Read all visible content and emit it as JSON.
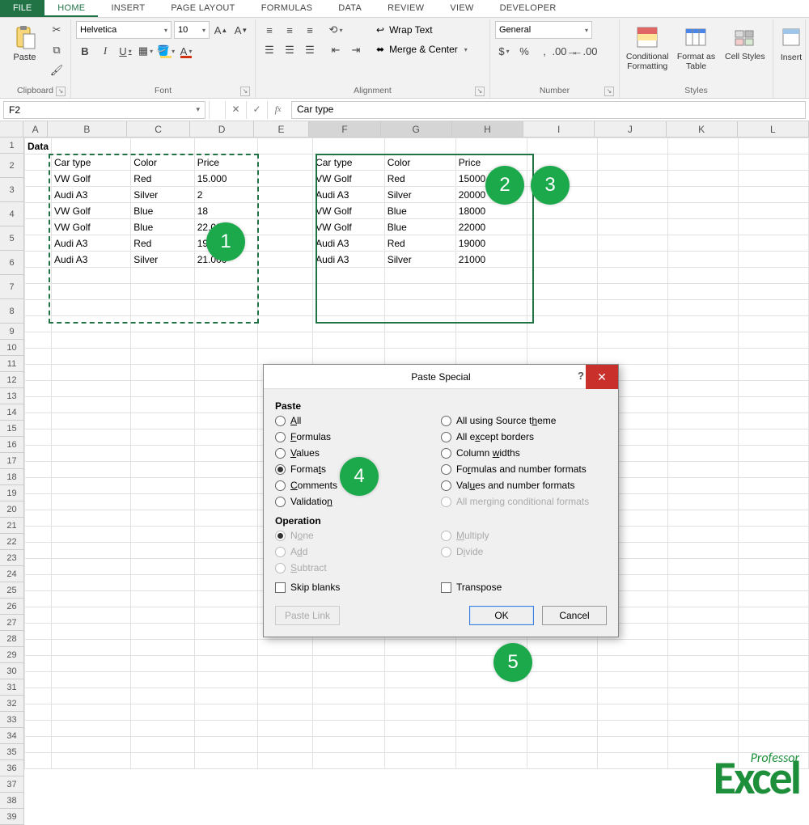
{
  "tabs": {
    "file": "FILE",
    "items": [
      "HOME",
      "INSERT",
      "PAGE LAYOUT",
      "FORMULAS",
      "DATA",
      "REVIEW",
      "VIEW",
      "DEVELOPER"
    ],
    "active": "HOME"
  },
  "ribbon": {
    "clipboard": {
      "paste": "Paste",
      "label": "Clipboard"
    },
    "font": {
      "name": "Helvetica",
      "size": "10",
      "label": "Font",
      "bold": "B",
      "italic": "I",
      "underline": "U"
    },
    "alignment": {
      "wrap": "Wrap Text",
      "merge": "Merge & Center",
      "label": "Alignment"
    },
    "number": {
      "format": "General",
      "label": "Number"
    },
    "styles": {
      "cond": "Conditional Formatting",
      "fmt": "Format as Table",
      "cell": "Cell Styles",
      "label": "Styles"
    },
    "cells": {
      "insert": "Insert"
    }
  },
  "formula_bar": {
    "name_box": "F2",
    "formula": "Car type"
  },
  "columns": [
    "A",
    "B",
    "C",
    "D",
    "E",
    "F",
    "G",
    "H",
    "I",
    "J",
    "K",
    "L"
  ],
  "col_widths": {
    "A": 30,
    "B": 100,
    "C": 80,
    "D": 80,
    "E": 70,
    "F": 90,
    "G": 90,
    "H": 90,
    "I": 90,
    "J": 90,
    "K": 90,
    "L": 90
  },
  "row_count": 39,
  "data_title": "Data",
  "left_headers": [
    "Car type",
    "Color",
    "Price"
  ],
  "left_rows": [
    [
      "VW Golf",
      "Red",
      "15.000"
    ],
    [
      "Audi A3",
      "Silver",
      "2"
    ],
    [
      "VW Golf",
      "Blue",
      "18"
    ],
    [
      "VW Golf",
      "Blue",
      "22.000"
    ],
    [
      "Audi A3",
      "Red",
      "19.000"
    ],
    [
      "Audi A3",
      "Silver",
      "21.000"
    ]
  ],
  "right_headers": [
    "Car type",
    "Color",
    "Price"
  ],
  "right_rows": [
    [
      "VW Golf",
      "Red",
      "15000"
    ],
    [
      "Audi A3",
      "Silver",
      "20000"
    ],
    [
      "VW Golf",
      "Blue",
      "18000"
    ],
    [
      "VW Golf",
      "Blue",
      "22000"
    ],
    [
      "Audi A3",
      "Red",
      "19000"
    ],
    [
      "Audi A3",
      "Silver",
      "21000"
    ]
  ],
  "dialog": {
    "title": "Paste Special",
    "paste": "Paste",
    "operation": "Operation",
    "options_left": [
      "All",
      "Formulas",
      "Values",
      "Formats",
      "Comments",
      "Validation"
    ],
    "options_right": [
      "All using Source theme",
      "All except borders",
      "Column widths",
      "Formulas and number formats",
      "Values and number formats",
      "All merging conditional formats"
    ],
    "selected": "Formats",
    "op_left": [
      "None",
      "Add",
      "Subtract"
    ],
    "op_right": [
      "Multiply",
      "Divide"
    ],
    "skip": "Skip blanks",
    "transpose": "Transpose",
    "paste_link": "Paste Link",
    "ok": "OK",
    "cancel": "Cancel"
  },
  "bubbles": {
    "b1": "1",
    "b2": "2",
    "b3": "3",
    "b4": "4",
    "b5": "5"
  },
  "logo": {
    "small": "Professor",
    "big": "Excel"
  }
}
